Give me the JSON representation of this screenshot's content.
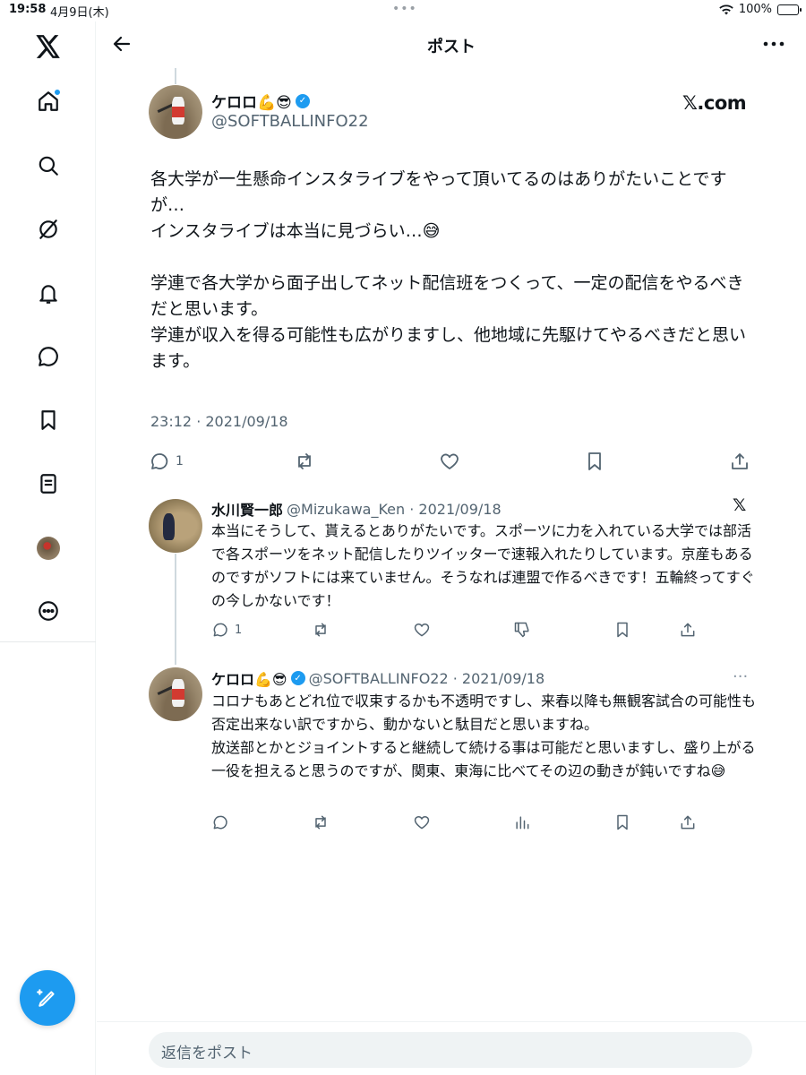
{
  "status_bar": {
    "time": "19:58",
    "date": "4月9日(木)",
    "battery": "100%"
  },
  "header": {
    "title": "ポスト"
  },
  "main_post": {
    "name": "ケロロ💪😎",
    "handle": "@SOFTBALLINFO22",
    "brand": "𝕏.com",
    "paragraphs": [
      "各大学が一生懸命インスタライブをやって頂いてるのはありがたいことですが…",
      "インスタライブは本当に見づらい…😅",
      "",
      "学連で各大学から面子出してネット配信班をつくって、一定の配信をやるべきだと思います。",
      "学連が収入を得る可能性も広がりますし、他地域に先駆けてやるべきだと思います。"
    ],
    "timestamp": "23:12 · 2021/09/18",
    "reply_count": "1"
  },
  "reply1": {
    "name": "水川賢一郎",
    "handle_date": "@Mizukawa_Ken · 2021/09/18",
    "brand": "𝕏",
    "paragraphs": [
      "本当にそうして、貰えるとありがたいです。スポーツに力を入れている大学では部活で各スポーツをネット配信したりツイッターで速報入れたりしています。京産もあるのですがソフトには来ていません。そうなれば連盟で作るべきです！五輪終ってすぐの今しかないです！"
    ],
    "reply_count": "1"
  },
  "reply2": {
    "name": "ケロロ💪😎",
    "handle_date": "@SOFTBALLINFO22 · 2021/09/18",
    "more": "···",
    "paragraphs": [
      "コロナもあとどれ位で収束するかも不透明ですし、来春以降も無観客試合の可能性も否定出来ない訳ですから、動かないと駄目だと思いますね。",
      "放送部とかとジョイントすると継続して続ける事は可能だと思いますし、盛り上がる一役を担えると思うのですが、関東、東海に比べてその辺の動きが鈍いですね😅"
    ]
  },
  "reply_bar": {
    "placeholder": "返信をポスト"
  },
  "colors": {
    "accent": "#1d9bf0",
    "text": "#0f1419",
    "muted": "#536471",
    "divider": "#eff3f4"
  }
}
